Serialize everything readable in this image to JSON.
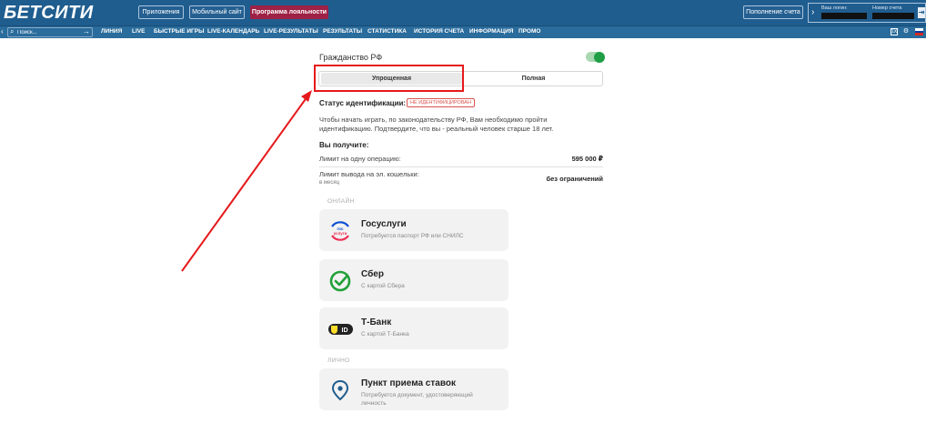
{
  "header": {
    "logo": "БЕТСИТИ",
    "apps_label": "Приложения",
    "mobile_label": "Мобильный сайт",
    "loyalty_label": "Программа лояльности",
    "deposit_label": "Пополнение счета",
    "login_label": "Ваш логин:",
    "account_label": "Номер счета",
    "login_button_icon": "logout-icon"
  },
  "nav": {
    "search_placeholder": "Поиск...",
    "items": [
      "ЛИНИЯ",
      "LIVE",
      "БЫСТРЫЕ ИГРЫ",
      "LIVE-КАЛЕНДАРЬ",
      "LIVE-РЕЗУЛЬТАТЫ",
      "РЕЗУЛЬТАТЫ",
      "СТАТИСТИКА",
      "ИСТОРИЯ СЧЕТА",
      "ИНФОРМАЦИЯ",
      "ПРОМО"
    ],
    "odds_icon_label": "1X",
    "flag_colors": [
      "#ffffff",
      "#0039a6",
      "#d52b1e"
    ]
  },
  "form": {
    "citizen_label": "Гражданство РФ",
    "citizen_toggle_on": true,
    "tabs": [
      "Упрощенная",
      "Полная"
    ],
    "active_tab": "Упрощенная",
    "status_label": "Статус идентификации:",
    "status_badge": "НЕ ИДЕНТИФИЦИРОВАН",
    "description_line1": "Чтобы начать играть, по законодательству РФ, Вам необходимо пройти",
    "description_line2": "идентификацию. Подтвердите, что вы - реальный человек старше 18 лет.",
    "receive_title": "Вы получите:",
    "limits": [
      {
        "label": "Лимит на одну операцию:",
        "value": "595 000 ₽",
        "sub": ""
      },
      {
        "label": "Лимит вывода на эл. кошельки:",
        "value": "без ограничений",
        "sub": "в месяц"
      }
    ]
  },
  "online": {
    "section_title": "ОНЛАЙН",
    "methods": [
      {
        "title": "Госуслуги",
        "subtitle": "Потребуется паспорт РФ или СНИЛС",
        "icon": "gosuslugi-icon",
        "icon_text": "гос услуги"
      },
      {
        "title": "Сбер",
        "subtitle": "С картой Сбера",
        "icon": "sber-icon"
      },
      {
        "title": "Т-Банк",
        "subtitle": "С картой Т-Банка",
        "icon": "tbank-icon",
        "icon_text": "ID"
      }
    ]
  },
  "personal": {
    "section_title": "ЛИЧНО",
    "methods": [
      {
        "title": "Пункт приема ставок",
        "subtitle_line1": "Потребуется документ, удостоверяющий",
        "subtitle_line2": "личность",
        "icon": "location-pin-icon"
      }
    ]
  },
  "colors": {
    "header_bg": "#1f5d8f",
    "nav_bg": "#2a6c9c",
    "loyalty_bg": "#9e2146",
    "toggle_on": "#1f9e45",
    "annotation_red": "#e5191b",
    "badge_red": "#d9534f",
    "gosuslugi_blue": "#0d4cd3",
    "gosuslugi_red": "#ee2f53",
    "sber_green": "#21a038",
    "tbank_yellow": "#ffdd2d"
  }
}
